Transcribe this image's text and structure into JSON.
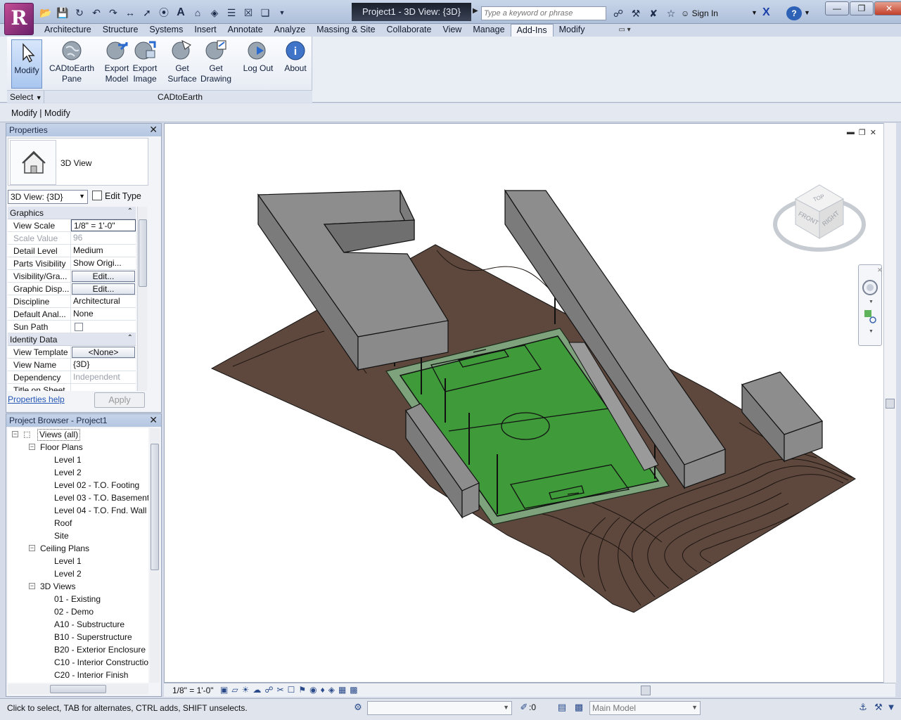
{
  "app": {
    "logo_letter": "R",
    "window_title": "Project1 - 3D View: {3D}",
    "search_placeholder": "Type a keyword or phrase",
    "sign_in": "Sign In",
    "help": "?"
  },
  "quick_access": [
    "open-icon",
    "save-icon",
    "sync-icon",
    "undo-icon",
    "redo-icon",
    "measure-icon",
    "dimension-icon",
    "tag-icon",
    "text-icon",
    "3d-view-icon",
    "section-icon",
    "thin-lines-icon",
    "close-hidden-icon",
    "switch-windows-icon"
  ],
  "ribbon_tabs": [
    {
      "label": "Architecture",
      "active": false
    },
    {
      "label": "Structure",
      "active": false
    },
    {
      "label": "Systems",
      "active": false
    },
    {
      "label": "Insert",
      "active": false
    },
    {
      "label": "Annotate",
      "active": false
    },
    {
      "label": "Analyze",
      "active": false
    },
    {
      "label": "Massing & Site",
      "active": false
    },
    {
      "label": "Collaborate",
      "active": false
    },
    {
      "label": "View",
      "active": false
    },
    {
      "label": "Manage",
      "active": false
    },
    {
      "label": "Add-Ins",
      "active": true
    },
    {
      "label": "Modify",
      "active": false
    }
  ],
  "ribbon": {
    "modify": "Modify",
    "pane_1": "CADtoEarth",
    "pane_2": "Pane",
    "export_model_1": "Export",
    "export_model_2": "Model",
    "export_image_1": "Export",
    "export_image_2": "Image",
    "get_surface_1": "Get",
    "get_surface_2": "Surface",
    "get_drawing_1": "Get",
    "get_drawing_2": "Drawing",
    "logout": "Log Out",
    "about": "About",
    "panel_select": "Select",
    "panel_name": "CADtoEarth"
  },
  "options_bar": "Modify | Modify",
  "properties": {
    "title": "Properties",
    "type_name": "3D View",
    "view_selector": "3D View: {3D}",
    "edit_type": "Edit Type",
    "groups": {
      "graphics": "Graphics",
      "identity": "Identity Data"
    },
    "rows": {
      "view_scale": {
        "key": "View Scale",
        "val": "1/8\" = 1'-0\""
      },
      "scale_value": {
        "key": "Scale Value",
        "val": "96"
      },
      "detail_level": {
        "key": "Detail Level",
        "val": "Medium"
      },
      "parts_visibility": {
        "key": "Parts Visibility",
        "val": "Show Origi..."
      },
      "visibility": {
        "key": "Visibility/Gra...",
        "val": "Edit..."
      },
      "graphic_display": {
        "key": "Graphic Disp...",
        "val": "Edit..."
      },
      "discipline": {
        "key": "Discipline",
        "val": "Architectural"
      },
      "default_analysis": {
        "key": "Default Anal...",
        "val": "None"
      },
      "sun_path": {
        "key": "Sun Path",
        "val": ""
      },
      "view_template": {
        "key": "View Template",
        "val": "<None>"
      },
      "view_name": {
        "key": "View Name",
        "val": "{3D}"
      },
      "dependency": {
        "key": "Dependency",
        "val": "Independent"
      },
      "title_on_sheet": {
        "key": "Title on Sheet",
        "val": ""
      }
    },
    "help": "Properties help",
    "apply": "Apply"
  },
  "browser": {
    "title": "Project Browser - Project1",
    "nodes": [
      {
        "label": "Views (all)",
        "indent": 0,
        "toggle": "-"
      },
      {
        "label": "Floor Plans",
        "indent": 1,
        "toggle": "-"
      },
      {
        "label": "Level 1",
        "indent": 2,
        "toggle": ""
      },
      {
        "label": "Level 2",
        "indent": 2,
        "toggle": ""
      },
      {
        "label": "Level 02 - T.O. Footing",
        "indent": 2,
        "toggle": ""
      },
      {
        "label": "Level 03 - T.O. Basement",
        "indent": 2,
        "toggle": ""
      },
      {
        "label": "Level 04 - T.O. Fnd. Wall",
        "indent": 2,
        "toggle": ""
      },
      {
        "label": "Roof",
        "indent": 2,
        "toggle": ""
      },
      {
        "label": "Site",
        "indent": 2,
        "toggle": ""
      },
      {
        "label": "Ceiling Plans",
        "indent": 1,
        "toggle": "-"
      },
      {
        "label": "Level 1",
        "indent": 2,
        "toggle": ""
      },
      {
        "label": "Level 2",
        "indent": 2,
        "toggle": ""
      },
      {
        "label": "3D Views",
        "indent": 1,
        "toggle": "-"
      },
      {
        "label": "01 - Existing",
        "indent": 2,
        "toggle": ""
      },
      {
        "label": "02 - Demo",
        "indent": 2,
        "toggle": ""
      },
      {
        "label": "A10 - Substructure",
        "indent": 2,
        "toggle": ""
      },
      {
        "label": "B10 - Superstructure",
        "indent": 2,
        "toggle": ""
      },
      {
        "label": "B20 - Exterior Enclosure",
        "indent": 2,
        "toggle": ""
      },
      {
        "label": "C10 - Interior Constructio",
        "indent": 2,
        "toggle": ""
      },
      {
        "label": "C20 - Interior Finish",
        "indent": 2,
        "toggle": ""
      }
    ]
  },
  "viewcube": {
    "top": "TOP",
    "front": "FRONT",
    "right": "RIGHT"
  },
  "view_bar": {
    "scale": "1/8\" = 1'-0\""
  },
  "status": {
    "message": "Click to select, TAB for alternates, CTRL adds, SHIFT unselects.",
    "filter_count": ":0",
    "model": "Main Model"
  },
  "colors": {
    "terrain": "#5e483d",
    "building": "#8a8a8a",
    "field": "#3f9a3a",
    "track": "#7da27c"
  }
}
